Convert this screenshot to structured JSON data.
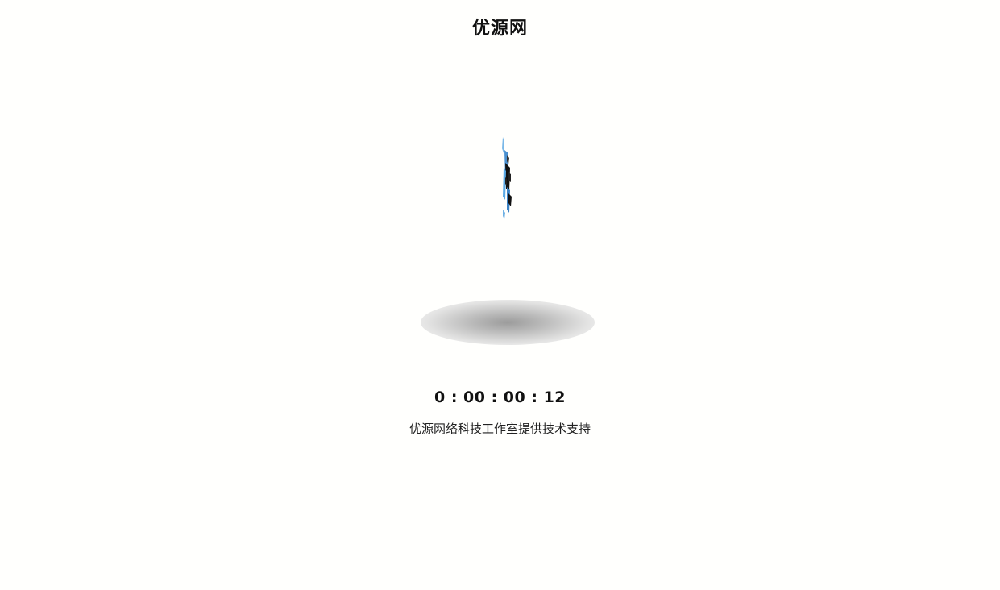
{
  "header": {
    "title": "优源网"
  },
  "loader": {
    "icon": "spinning-logo-icon",
    "accent_color": "#5aa9e6"
  },
  "countdown": {
    "text": "0 : 00 : 00 : 12"
  },
  "footer": {
    "support_text": "优源网络科技工作室提供技术支持"
  }
}
